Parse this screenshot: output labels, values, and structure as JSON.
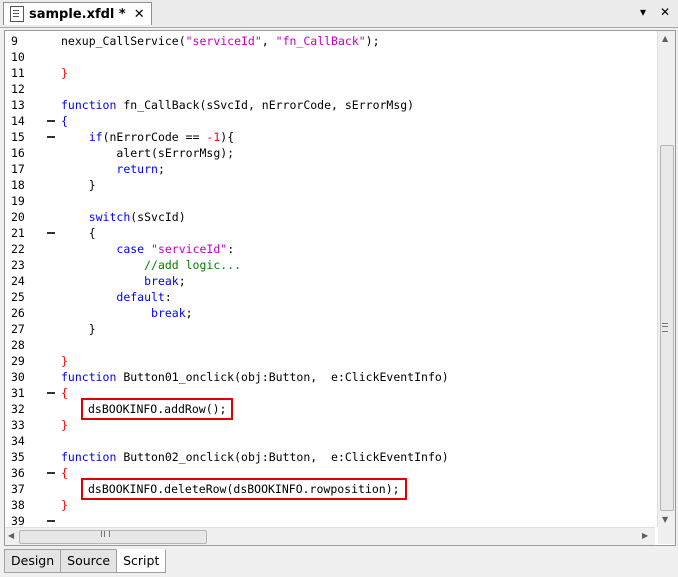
{
  "tab": {
    "title": "sample.xfdl *",
    "close": "✕"
  },
  "window_controls": {
    "menu": "▾",
    "close": "✕"
  },
  "editor": {
    "lines": [
      {
        "n": "9",
        "fold": false,
        "segments": [
          [
            "",
            "nexup_CallService("
          ],
          [
            "str",
            "\"serviceId\""
          ],
          [
            "",
            ", "
          ],
          [
            "str",
            "\"fn_CallBack\""
          ],
          [
            "",
            ");"
          ]
        ]
      },
      {
        "n": "10",
        "fold": false,
        "segments": []
      },
      {
        "n": "11",
        "fold": false,
        "segments": [
          [
            "num",
            "}"
          ]
        ]
      },
      {
        "n": "12",
        "fold": false,
        "segments": []
      },
      {
        "n": "13",
        "fold": false,
        "segments": [
          [
            "kw",
            "function"
          ],
          [
            "",
            " fn_CallBack(sSvcId, nErrorCode, sErrorMsg)"
          ]
        ]
      },
      {
        "n": "14",
        "fold": true,
        "segments": [
          [
            "kw",
            "{"
          ]
        ]
      },
      {
        "n": "15",
        "fold": true,
        "segments": [
          [
            "",
            "    "
          ],
          [
            "kw",
            "if"
          ],
          [
            "",
            "(nErrorCode == "
          ],
          [
            "num",
            "-1"
          ],
          [
            "",
            "){"
          ]
        ]
      },
      {
        "n": "16",
        "fold": false,
        "segments": [
          [
            "",
            "        alert(sErrorMsg);"
          ]
        ]
      },
      {
        "n": "17",
        "fold": false,
        "segments": [
          [
            "",
            "        "
          ],
          [
            "kw",
            "return"
          ],
          [
            "",
            ";"
          ]
        ]
      },
      {
        "n": "18",
        "fold": false,
        "segments": [
          [
            "",
            "    }"
          ]
        ]
      },
      {
        "n": "19",
        "fold": false,
        "segments": []
      },
      {
        "n": "20",
        "fold": false,
        "segments": [
          [
            "",
            "    "
          ],
          [
            "kw",
            "switch"
          ],
          [
            "",
            "(sSvcId)"
          ]
        ]
      },
      {
        "n": "21",
        "fold": true,
        "segments": [
          [
            "",
            "    {"
          ]
        ]
      },
      {
        "n": "22",
        "fold": false,
        "segments": [
          [
            "",
            "        "
          ],
          [
            "kw",
            "case"
          ],
          [
            "",
            " "
          ],
          [
            "str",
            "\"serviceId\""
          ],
          [
            "",
            ":"
          ]
        ]
      },
      {
        "n": "23",
        "fold": false,
        "segments": [
          [
            "",
            "            "
          ],
          [
            "cm",
            "//add logic..."
          ]
        ]
      },
      {
        "n": "24",
        "fold": false,
        "segments": [
          [
            "",
            "            "
          ],
          [
            "kw",
            "break"
          ],
          [
            "",
            ";"
          ]
        ]
      },
      {
        "n": "25",
        "fold": false,
        "segments": [
          [
            "",
            "        "
          ],
          [
            "kw",
            "default"
          ],
          [
            "",
            ":"
          ]
        ]
      },
      {
        "n": "26",
        "fold": false,
        "segments": [
          [
            "",
            "             "
          ],
          [
            "kw",
            "break"
          ],
          [
            "",
            ";"
          ]
        ]
      },
      {
        "n": "27",
        "fold": false,
        "segments": [
          [
            "",
            "    }"
          ]
        ]
      },
      {
        "n": "28",
        "fold": false,
        "segments": []
      },
      {
        "n": "29",
        "fold": false,
        "segments": [
          [
            "num",
            "}"
          ]
        ]
      },
      {
        "n": "30",
        "fold": false,
        "segments": [
          [
            "kw",
            "function"
          ],
          [
            "",
            " Button01_onclick(obj:Button,  e:ClickEventInfo)"
          ]
        ]
      },
      {
        "n": "31",
        "fold": true,
        "segments": [
          [
            "num",
            "{"
          ]
        ]
      },
      {
        "n": "32",
        "fold": false,
        "highlight": true,
        "segments": [
          [
            "",
            "dsBOOKINFO.addRow();"
          ]
        ]
      },
      {
        "n": "33",
        "fold": false,
        "segments": [
          [
            "num",
            "}"
          ]
        ]
      },
      {
        "n": "34",
        "fold": false,
        "segments": []
      },
      {
        "n": "35",
        "fold": false,
        "segments": [
          [
            "kw",
            "function"
          ],
          [
            "",
            " Button02_onclick(obj:Button,  e:ClickEventInfo)"
          ]
        ]
      },
      {
        "n": "36",
        "fold": true,
        "segments": [
          [
            "num",
            "{"
          ]
        ]
      },
      {
        "n": "37",
        "fold": false,
        "highlight": true,
        "segments": [
          [
            "",
            "dsBOOKINFO.deleteRow(dsBOOKINFO.rowposition);"
          ]
        ]
      },
      {
        "n": "38",
        "fold": false,
        "segments": [
          [
            "num",
            "}"
          ]
        ]
      },
      {
        "n": "39",
        "fold": true,
        "segments": []
      }
    ]
  },
  "bottom_tabs": [
    "Design",
    "Source",
    "Script"
  ],
  "active_bottom_tab": "Script",
  "colors": {
    "keyword": "#0000ff",
    "string": "#c000c0",
    "number": "#ff0000",
    "comment": "#008000",
    "highlight_box": "#e00000"
  },
  "icons": {
    "file": "document-icon",
    "tab_close": "close-icon",
    "menu": "chevron-down-icon",
    "window_close": "close-icon"
  }
}
